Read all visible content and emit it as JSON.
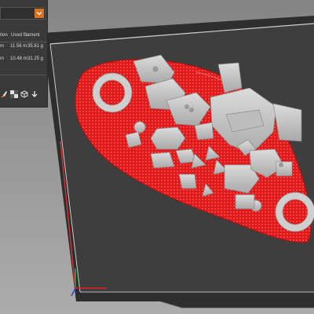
{
  "info_panel": {
    "header_left": "tion",
    "header_right": "Used filament",
    "rows": [
      {
        "left": "m",
        "length": "11.56 m",
        "weight": "35.61 g"
      },
      {
        "left": "m",
        "length": "10.48 m",
        "weight": "31.25 g"
      }
    ],
    "toolbar_icons": [
      "paint-brush-icon",
      "checker-icon",
      "cube-icon",
      "arrow-down-icon"
    ]
  },
  "colors": {
    "accent": "#d9731e",
    "bed": "#3e3e3e",
    "support": "#e21b1b",
    "part": "#c8c8c8"
  }
}
